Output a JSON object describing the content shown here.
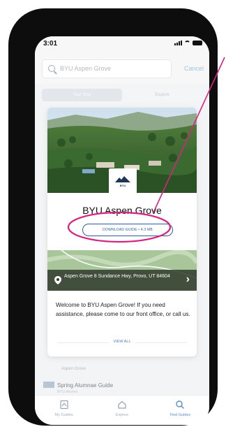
{
  "status_bar": {
    "time": "3:01"
  },
  "search": {
    "query": "BYU Aspen Grove",
    "cancel_label": "Cancel"
  },
  "tabs": [
    {
      "label": "Your Stay",
      "active": true
    },
    {
      "label": "Explore",
      "active": false
    }
  ],
  "card": {
    "logo_text": "BYU",
    "title": "BYU Aspen Grove",
    "download_label": "DOWNLOAD GUIDE • 4.3 MB",
    "address": "Aspen Grove 8 Sundance Hwy, Provo, UT 84604",
    "description": "Welcome to BYU Aspen Grove! If you need assistance, please come to our front office, or call us.",
    "view_all_label": "VIEW ALL"
  },
  "below_list": {
    "item_1_text": "Aspen Grove",
    "item_2_title": "Spring Alumnae Guide",
    "item_2_sub": "BYU Alumni"
  },
  "bottom_nav": [
    {
      "label": "My Guides",
      "icon": "guides-icon",
      "active": false
    },
    {
      "label": "Explore",
      "icon": "home-icon",
      "active": false
    },
    {
      "label": "Find Guides",
      "icon": "search-icon",
      "active": true
    }
  ],
  "colors": {
    "accent": "#2c5d9e",
    "annotation": "#d5247f",
    "phone_frame": "#0d0d0d"
  }
}
